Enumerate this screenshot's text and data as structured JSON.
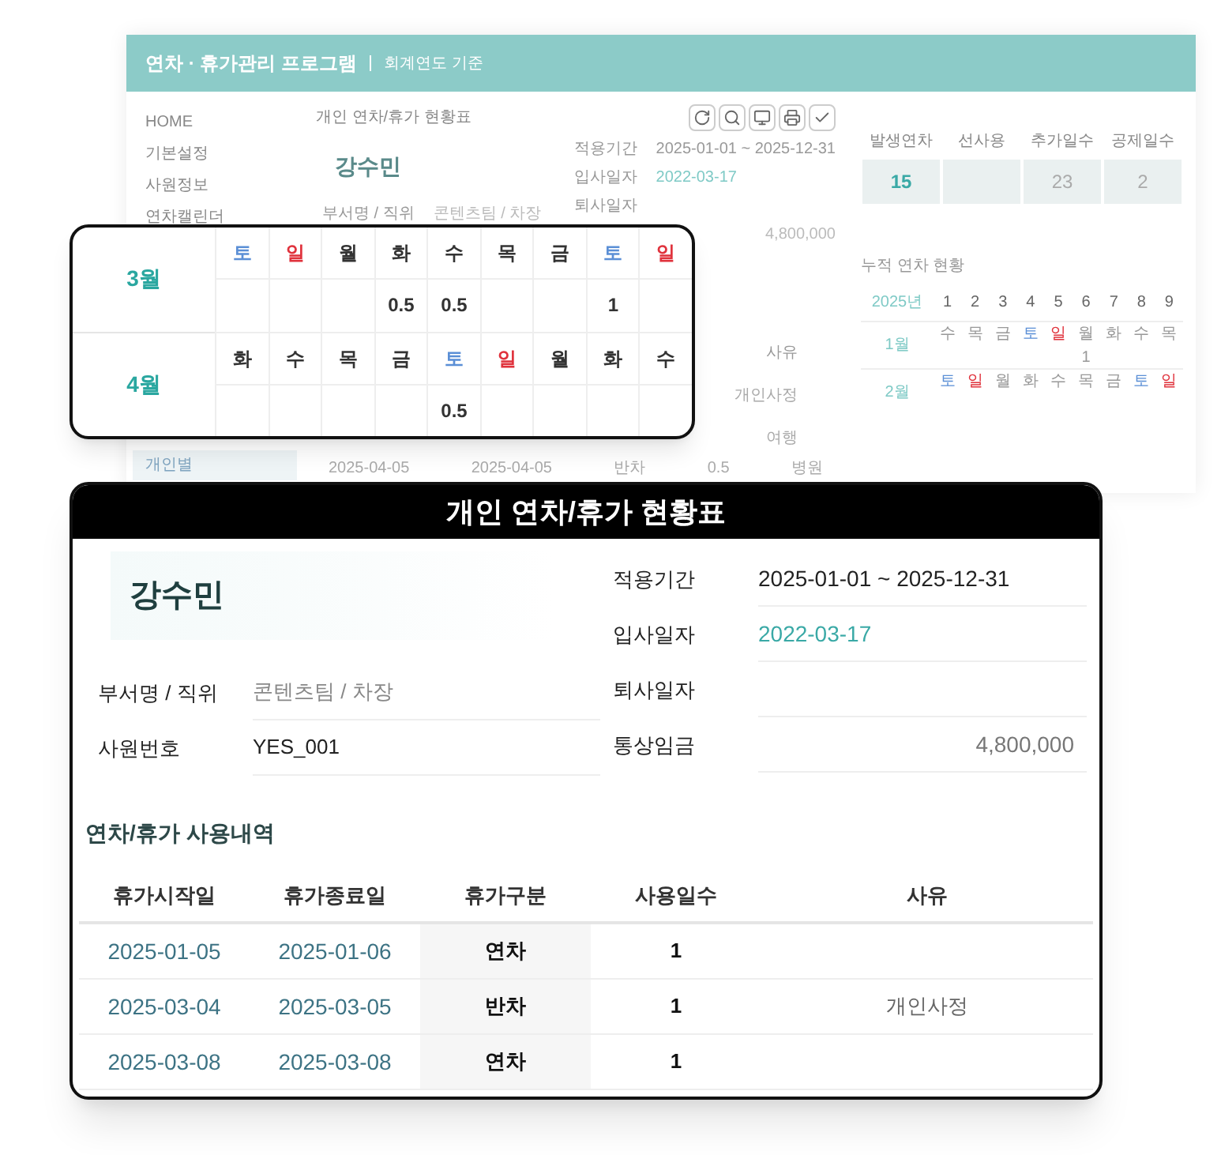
{
  "app": {
    "title": "연차 · 휴가관리 프로그램",
    "subtitle": "회계연도 기준",
    "sidebar": [
      {
        "label": "HOME",
        "selected": false
      },
      {
        "label": "기본설정",
        "selected": false
      },
      {
        "label": "사원정보",
        "selected": false
      },
      {
        "label": "연차캘린더",
        "selected": false
      },
      {
        "label": "개인별",
        "selected": true
      }
    ],
    "panel_title": "개인 연차/휴가 현황표",
    "name": "강수민",
    "dept_label": "부서명 / 직위",
    "dept_value": "콘텐츠팀 / 차장",
    "fields": [
      {
        "label": "적용기간",
        "value": "2025-01-01 ~ 2025-12-31",
        "kind": "plain"
      },
      {
        "label": "입사일자",
        "value": "2022-03-17",
        "kind": "accent"
      },
      {
        "label": "퇴사일자"
      }
    ],
    "wage": "4,800,000",
    "history": {
      "header": "사유",
      "reasons": [
        "개인사정",
        "여행"
      ],
      "last_row": [
        "2025-04-05",
        "2025-04-05",
        "반차",
        "0.5",
        "병원"
      ]
    },
    "summary": [
      {
        "label": "발생연차",
        "value": "15"
      },
      {
        "label": "선사용"
      },
      {
        "label": "추가일수",
        "value": "23"
      },
      {
        "label": "공제일수",
        "value": "2"
      }
    ],
    "calendar": {
      "title": "누적 연차 현황",
      "year": "2025년",
      "days": [
        "1",
        "2",
        "3",
        "4",
        "5",
        "6",
        "7",
        "8",
        "9"
      ],
      "months": [
        {
          "label": "1월",
          "days": [
            {
              "label": "수",
              "kind": "weekday"
            },
            {
              "label": "목",
              "kind": "weekday"
            },
            {
              "label": "금",
              "kind": "weekday"
            },
            {
              "label": "토",
              "kind": "sat"
            },
            {
              "label": "일",
              "kind": "sun"
            },
            {
              "label": "월",
              "kind": "weekday",
              "value": "1"
            },
            {
              "label": "화",
              "kind": "weekday"
            },
            {
              "label": "수",
              "kind": "weekday"
            },
            {
              "label": "목",
              "kind": "weekday"
            }
          ]
        },
        {
          "label": "2월",
          "days": [
            {
              "label": "토",
              "kind": "sat"
            },
            {
              "label": "일",
              "kind": "sun"
            },
            {
              "label": "월",
              "kind": "weekday"
            },
            {
              "label": "화",
              "kind": "weekday"
            },
            {
              "label": "수",
              "kind": "weekday"
            },
            {
              "label": "목",
              "kind": "weekday"
            },
            {
              "label": "금",
              "kind": "weekday"
            },
            {
              "label": "토",
              "kind": "sat"
            },
            {
              "label": "일",
              "kind": "sun"
            }
          ]
        }
      ]
    }
  },
  "zoom_calendar": [
    {
      "label": "3월",
      "days": [
        {
          "label": "토",
          "kind": "sat"
        },
        {
          "label": "일",
          "kind": "sun"
        },
        {
          "label": "월",
          "kind": "weekday"
        },
        {
          "label": "화",
          "kind": "weekday",
          "value": "0.5"
        },
        {
          "label": "수",
          "kind": "weekday",
          "value": "0.5"
        },
        {
          "label": "목",
          "kind": "weekday"
        },
        {
          "label": "금",
          "kind": "weekday"
        },
        {
          "label": "토",
          "kind": "sat",
          "value": "1"
        },
        {
          "label": "일",
          "kind": "sun"
        }
      ]
    },
    {
      "label": "4월",
      "days": [
        {
          "label": "화",
          "kind": "weekday"
        },
        {
          "label": "수",
          "kind": "weekday"
        },
        {
          "label": "목",
          "kind": "weekday"
        },
        {
          "label": "금",
          "kind": "weekday"
        },
        {
          "label": "토",
          "kind": "sat",
          "value": "0.5"
        },
        {
          "label": "일",
          "kind": "sun"
        },
        {
          "label": "월",
          "kind": "weekday"
        },
        {
          "label": "화",
          "kind": "weekday"
        },
        {
          "label": "수",
          "kind": "weekday"
        }
      ]
    }
  ],
  "report": {
    "title": "개인 연차/휴가 현황표",
    "name": "강수민",
    "left_fields": [
      {
        "label": "부서명 / 직위",
        "value": "콘텐츠팀 / 차장",
        "kind": "muted"
      },
      {
        "label": "사원번호",
        "value": "YES_001",
        "kind": "plain"
      }
    ],
    "right_fields": [
      {
        "label": "적용기간",
        "value": "2025-01-01 ~ 2025-12-31",
        "kind": "plain"
      },
      {
        "label": "입사일자",
        "value": "2022-03-17",
        "kind": "accent"
      },
      {
        "label": "퇴사일자"
      },
      {
        "label": "통상임금",
        "value": "4,800,000",
        "kind": "amount"
      }
    ],
    "history_title": "연차/휴가 사용내역",
    "columns": [
      "휴가시작일",
      "휴가종료일",
      "휴가구분",
      "사용일수",
      "사유"
    ],
    "rows": [
      [
        "2025-01-05",
        "2025-01-06",
        "연차",
        "1",
        ""
      ],
      [
        "2025-03-04",
        "2025-03-05",
        "반차",
        "1",
        "개인사정"
      ],
      [
        "2025-03-08",
        "2025-03-08",
        "연차",
        "1",
        ""
      ]
    ]
  }
}
